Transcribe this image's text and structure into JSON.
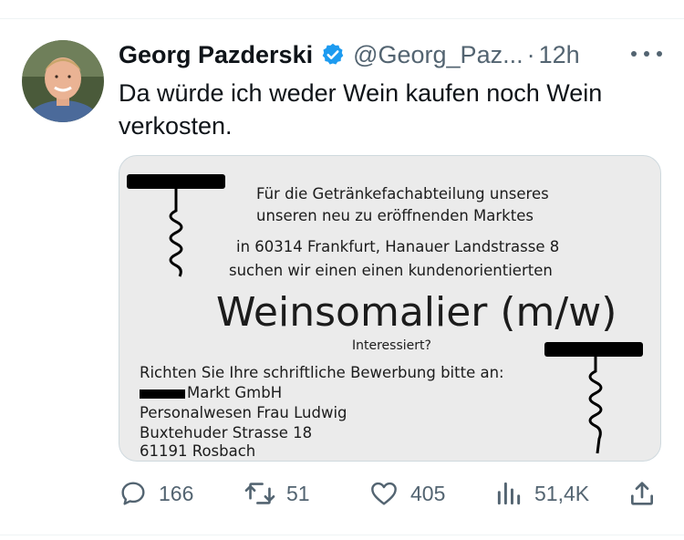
{
  "tweet": {
    "author_name": "Georg Pazderski",
    "handle": "@Georg_Paz...",
    "separator": "·",
    "time": "12h",
    "text": "Da würde ich weder Wein kaufen noch Wein verkosten."
  },
  "media": {
    "lines": [
      "Für die Getränkefachabteilung unseres",
      "unseren neu zu eröffnenden Marktes",
      "in 60314 Frankfurt, Hanauer Landstrasse 8",
      "suchen wir einen einen kundenorientierten"
    ],
    "headline": "Weinsomalier (m/w)",
    "question": "Interessiert?",
    "apply_intro": "Richten Sie Ihre schriftliche Bewerbung bitte an:",
    "company_suffix": "Markt GmbH",
    "contact": "Personalwesen Frau Ludwig",
    "street": "Buxtehuder Strasse 18",
    "city": "61191 Rosbach"
  },
  "actions": {
    "replies": "166",
    "retweets": "51",
    "likes": "405",
    "views": "51,4K"
  },
  "icons": {
    "verified": "verified-badge-icon",
    "more": "more-options-icon",
    "reply": "reply-icon",
    "retweet": "retweet-icon",
    "like": "heart-icon",
    "views": "views-chart-icon",
    "share": "share-icon"
  },
  "colors": {
    "verified_blue": "#1d9bf0",
    "secondary_text": "#536471",
    "primary_text": "#0f1419"
  }
}
